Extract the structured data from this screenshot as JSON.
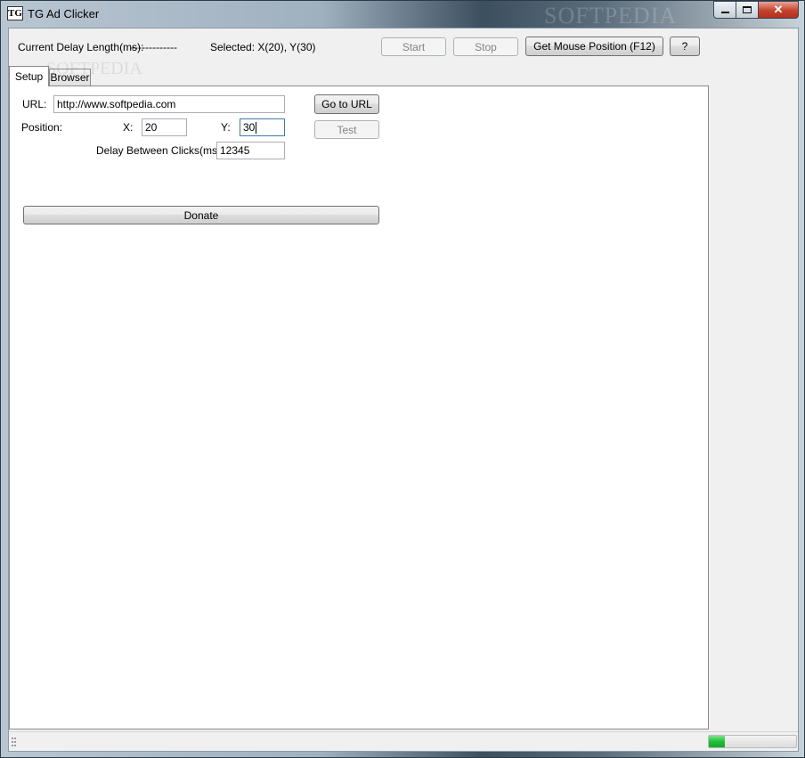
{
  "window": {
    "title": "TG Ad Clicker",
    "icon_text": "TG",
    "watermark": "SOFTPEDIA"
  },
  "toolbar": {
    "delay_label": "Current Delay Length(ms):",
    "delay_value": "-------------",
    "selected_text": "Selected: X(20), Y(30)",
    "start_label": "Start",
    "stop_label": "Stop",
    "get_mouse_label": "Get Mouse Position (F12)",
    "help_label": "?"
  },
  "tabs": [
    {
      "label": "Setup",
      "active": true
    },
    {
      "label": "Browser",
      "active": false
    }
  ],
  "setup": {
    "url_label": "URL:",
    "url_value": "http://www.softpedia.com",
    "go_url_label": "Go to URL",
    "position_label": "Position:",
    "x_label": "X:",
    "x_value": "20",
    "y_label": "Y:",
    "y_value": "30",
    "test_label": "Test",
    "delay_between_label": "Delay Between Clicks(ms):",
    "delay_between_value": "12345",
    "donate_label": "Donate"
  },
  "statusbar": {
    "progress_fraction": 0.18
  },
  "colors": {
    "accent_green": "#1fbf3a",
    "close_red": "#c5432d"
  }
}
